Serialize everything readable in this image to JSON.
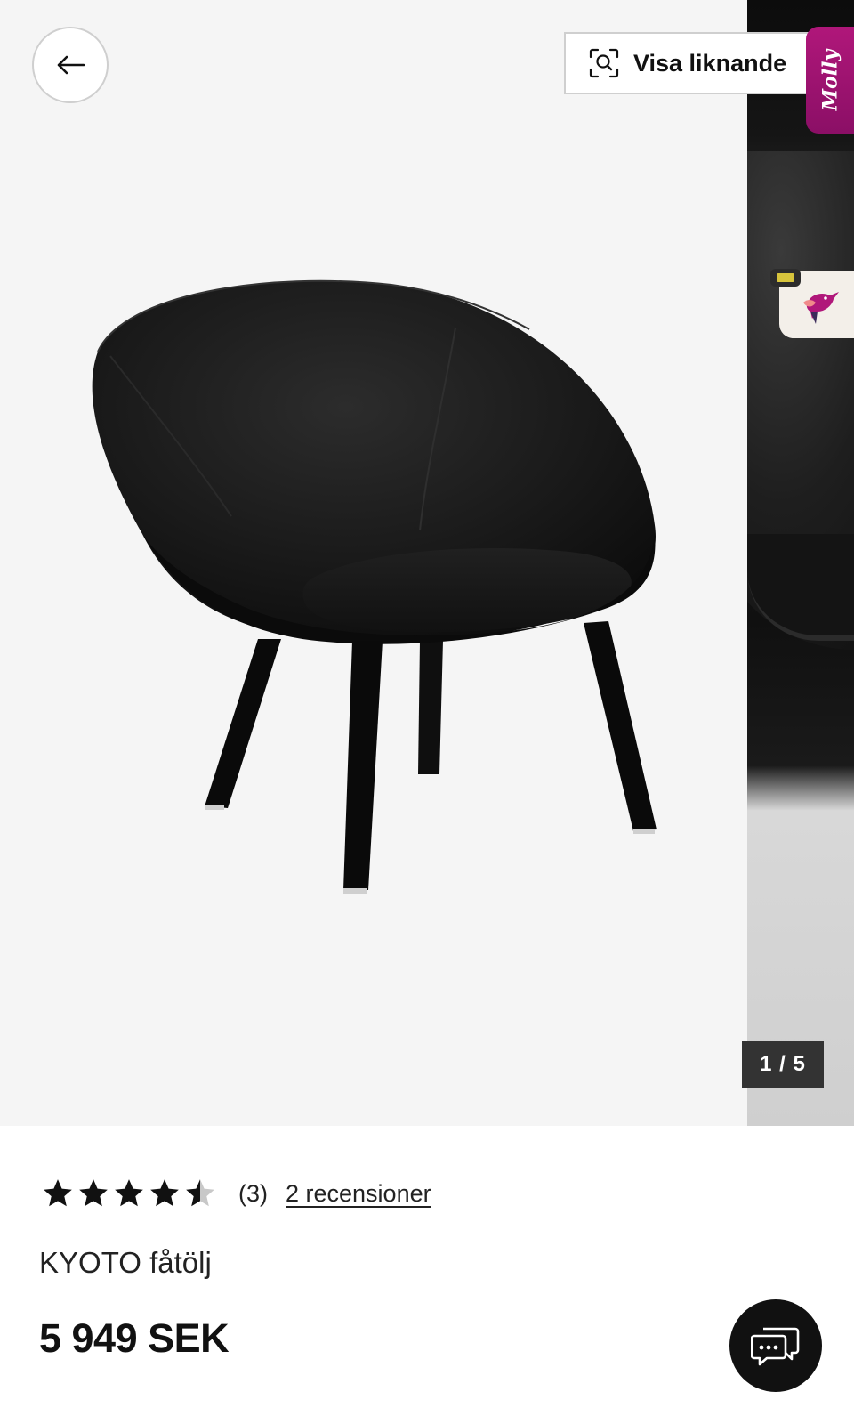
{
  "gallery": {
    "similar_button_label": "Visa liknande",
    "molly_tab_label": "Molly",
    "pager_text": "1 / 5",
    "current_image": 1,
    "total_images": 5
  },
  "product": {
    "rating_value": 4.5,
    "rating_max": 5,
    "rating_count_text": "(3)",
    "reviews_link_text": "2 recensioner",
    "title": "KYOTO fåtölj",
    "price": "5 949 SEK"
  },
  "icons": {
    "back": "arrow-left-icon",
    "similar": "visual-search-icon",
    "chat": "chat-bubbles-icon",
    "assistant": "hummingbird-icon"
  },
  "colors": {
    "molly_accent": "#9c1270",
    "pager_bg": "#333333",
    "chat_button_bg": "#111111",
    "star_fill": "#111111"
  }
}
